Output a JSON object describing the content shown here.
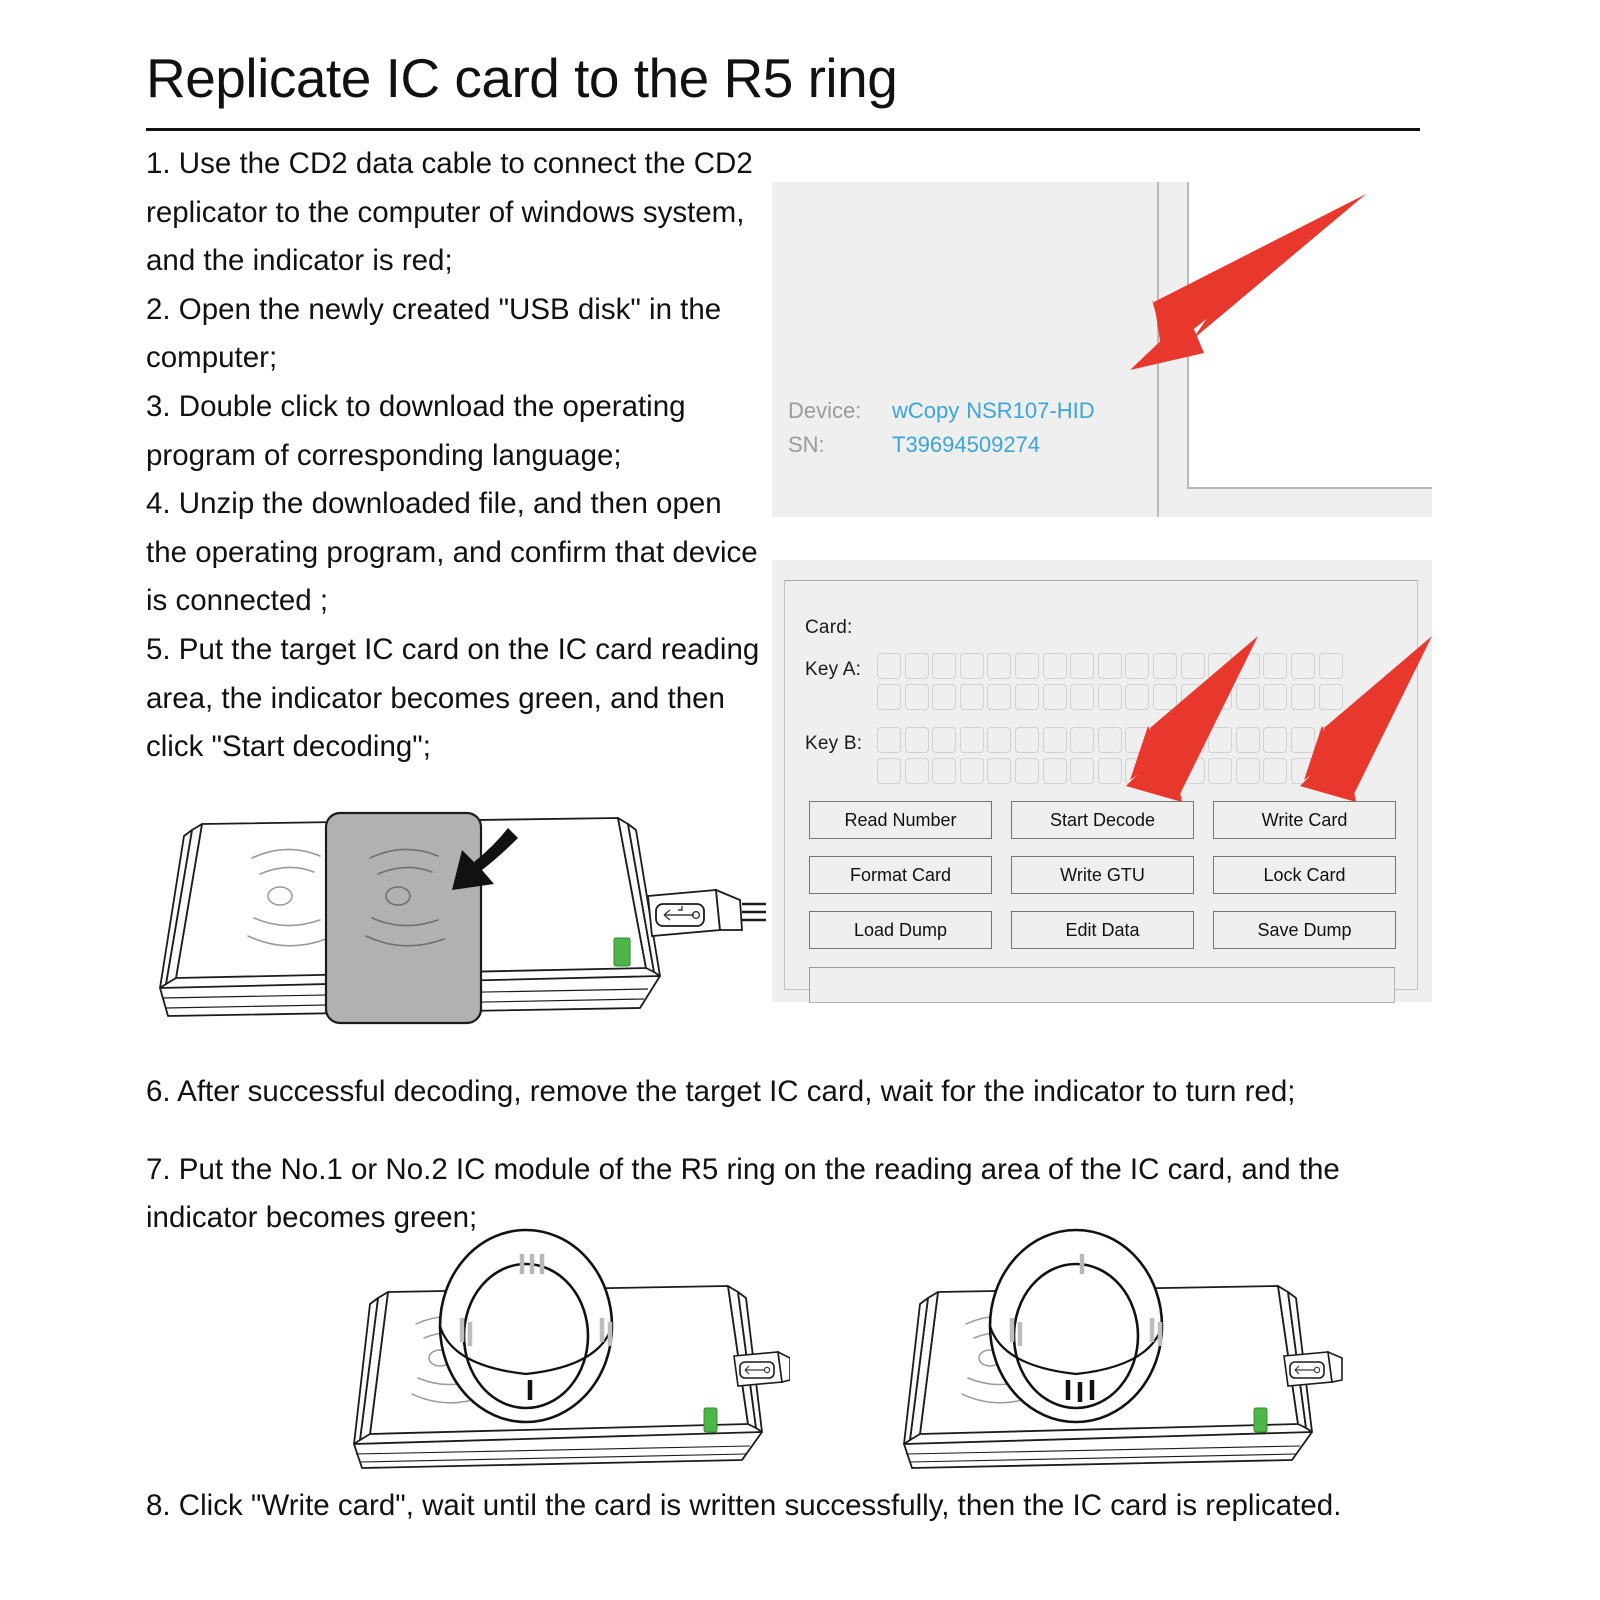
{
  "document": {
    "title": "Replicate IC card to the R5 ring"
  },
  "steps_left": [
    "1. Use the CD2 data cable to connect the CD2 replicator to the computer of windows system, and the indicator is red;",
    "2. Open the newly created \"USB disk\" in the computer;",
    "3. Double click to download the operating program of corresponding language;",
    "4. Unzip the downloaded file, and then open the operating program, and confirm that device is connected ;",
    "5. Put the target IC card on the IC card reading area, the indicator becomes green, and then click \"Start decoding\";"
  ],
  "steps_mid": [
    "6. After successful decoding, remove the target IC card, wait for the indicator to turn red;",
    "7. Put the No.1 or No.2 IC module of the R5 ring on the reading area of the IC card, and the indicator becomes green;"
  ],
  "step_last": "8. Click \"Write card\", wait until the card is written successfully, then the IC card is replicated.",
  "device_panel": {
    "device_label": "Device:",
    "device_brand": "wCopy",
    "device_model": "NSR107-HID",
    "sn_label": "SN:",
    "sn_value": "T39694509274"
  },
  "software_panel": {
    "card_label": "Card:",
    "key_a_label": "Key A:",
    "key_b_label": "Key B:",
    "hex_boxes_per_row": 17,
    "card_value": "",
    "key_a_value": "",
    "key_b_value": "",
    "status_text": "",
    "buttons": [
      "Read Number",
      "Start Decode",
      "Write Card",
      "Format Card",
      "Write GTU",
      "Lock Card",
      "Load Dump",
      "Edit Data",
      "Save Dump"
    ]
  },
  "colors": {
    "arrow_red": "#e8382e",
    "panel_grey": "#efefef",
    "device_value_blue": "#3aa6d8",
    "device_label_grey": "#9b9b9b",
    "led_green": "#4cb648",
    "card_grey": "#b1b1b1"
  },
  "illustrations": {
    "card_on_reader": "CD2 replicator with IC card placed on right reading area, black arrow and green indicator",
    "ring_module_1": "R5 ring standing on reader, No.1 IC module at top",
    "ring_module_2": "R5 ring standing on reader, No.2 IC module at bottom"
  }
}
